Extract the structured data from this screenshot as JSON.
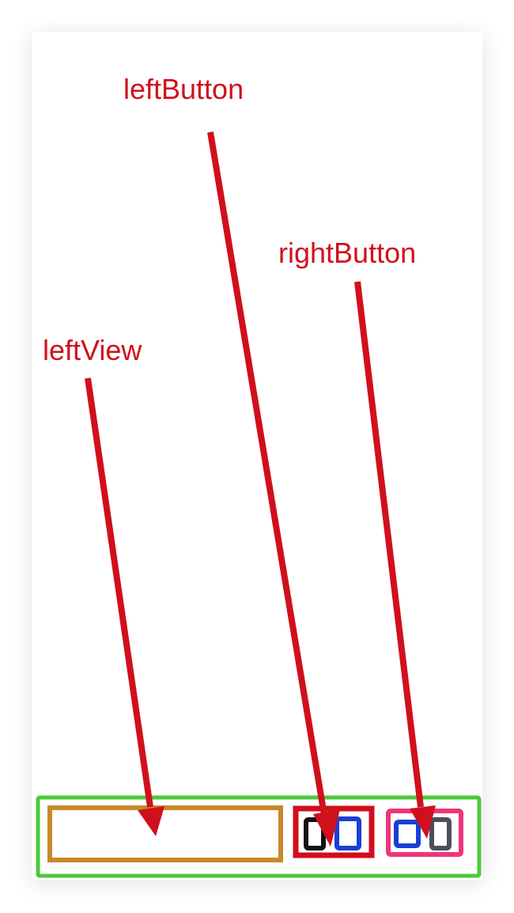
{
  "labels": {
    "left_button": "leftButton",
    "right_button": "rightButton",
    "left_view": "leftView"
  },
  "colors": {
    "annotation": "#d0101c",
    "container_border": "#4cc93a",
    "left_view_border": "#c8892a",
    "left_button_border": "#d0101c",
    "right_button_border": "#f0347a",
    "icon_dark": "#111111",
    "icon_blue": "#1a3fd6",
    "icon_gray": "#4a4f5c",
    "background": "#ffffff"
  },
  "icons": {
    "left_button": [
      "dark-rect-icon",
      "blue-rect-icon"
    ],
    "right_button": [
      "blue-rect-icon",
      "gray-rect-icon"
    ]
  }
}
